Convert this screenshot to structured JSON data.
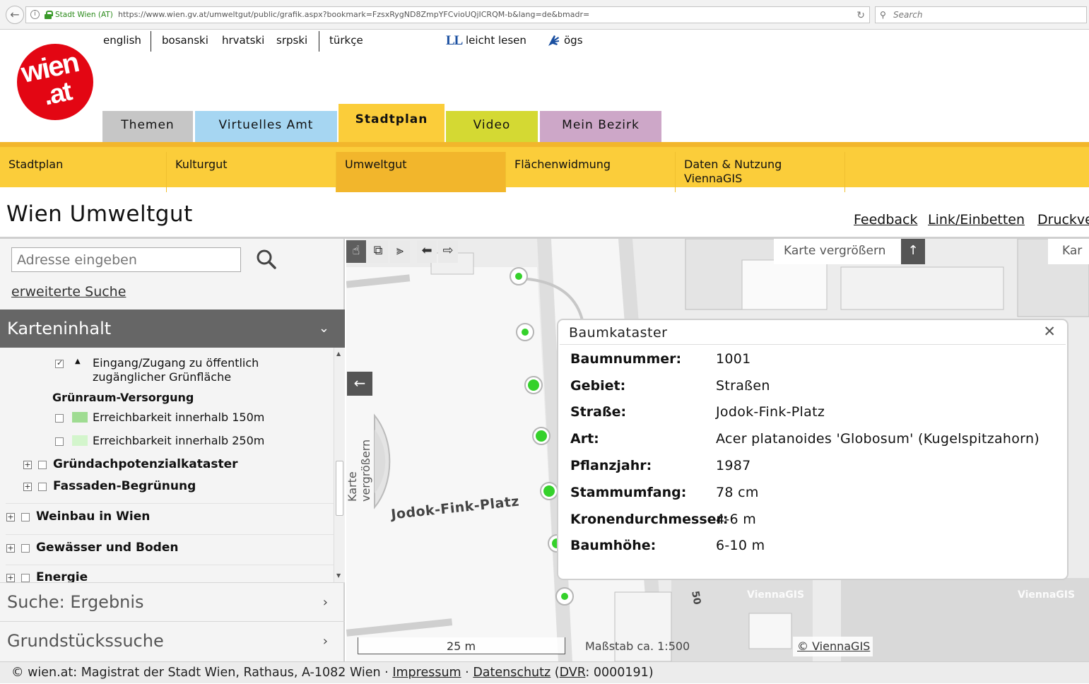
{
  "browser": {
    "site_identity": "Stadt Wien (AT)",
    "url": "https://www.wien.gv.at/umweltgut/public/grafik.aspx?bookmark=FzsxRygND8ZmpYFCvioUQjICRQM-b&lang=de&bmadr=",
    "search_placeholder": "Search"
  },
  "logo": {
    "line1": "wien",
    "line2": ".at"
  },
  "languages": [
    "english",
    "bosanski",
    "hrvatski",
    "srpski",
    "türkçe"
  ],
  "accessibility": {
    "ll_badge": "LL",
    "easy_read": "leicht lesen",
    "sign_language": "ögs"
  },
  "main_tabs": [
    {
      "label": "Themen",
      "color": "#c6c6c6"
    },
    {
      "label": "Virtuelles Amt",
      "color": "#a6d6f2"
    },
    {
      "label": "Stadtplan",
      "color": "#fbcd3a"
    },
    {
      "label": "Video",
      "color": "#d4d933"
    },
    {
      "label": "Mein Bezirk",
      "color": "#cda7c8"
    }
  ],
  "sub_tabs": [
    "Stadtplan",
    "Kulturgut",
    "Umweltgut",
    "Flächenwidmung",
    "Daten & Nutzung",
    "ViennaGIS"
  ],
  "page": {
    "title": "Wien Umweltgut",
    "links": [
      "Feedback",
      "Link/Einbetten",
      "Druckve"
    ]
  },
  "left_panel": {
    "address_placeholder": "Adresse eingeben",
    "advanced_search": "erweiterte Suche",
    "karteninhalt": "Karteninhalt",
    "layers": {
      "entry_line1": "Eingang/Zugang zu öffentlich",
      "entry_line2": "zugänglicher Grünfläche",
      "group_heading": "Grünraum-Versorgung",
      "reach150": "Erreichbarkeit innerhalb 150m",
      "reach250": "Erreichbarkeit innerhalb 250m",
      "roof": "Gründachpotenzialkataster",
      "facade": "Fassaden-Begrünung",
      "wine": "Weinbau in Wien",
      "water": "Gewässer und Boden",
      "energy": "Energie"
    },
    "swatch_colors": {
      "reach150": "#9fdc92",
      "reach250": "#d3f5cc"
    },
    "accordions": [
      "Suche: Ergebnis",
      "Grundstückssuche"
    ]
  },
  "map": {
    "tools": [
      "hand-tool",
      "zoom-box-tool",
      "measure-tool",
      "back-tool",
      "forward-tool"
    ],
    "enlarge_label": "Karte vergrößern",
    "enlarge_label_cut": "Kar",
    "side_label": "Karte vergrößern",
    "place_label": "Jodok-Fink-Platz",
    "watermark": "ViennaGIS",
    "street_number": "50",
    "scale_label": "25 m",
    "scale_ratio": "Maßstab ca. 1:500",
    "credit": "© ViennaGIS",
    "tree_color": "#35d12b"
  },
  "popup": {
    "title": "Baumkataster",
    "rows": [
      {
        "label": "Baumnummer:",
        "value": "1001"
      },
      {
        "label": "Gebiet:",
        "value": "Straßen"
      },
      {
        "label": "Straße:",
        "value": "Jodok-Fink-Platz"
      },
      {
        "label": "Art:",
        "value": "Acer platanoides 'Globosum' (Kugelspitzahorn)"
      },
      {
        "label": "Pflanzjahr:",
        "value": "1987"
      },
      {
        "label": "Stammumfang:",
        "value": "78 cm"
      },
      {
        "label": "Kronendurchmesser:",
        "value": "4-6 m"
      },
      {
        "label": "Baumhöhe:",
        "value": "6-10 m"
      }
    ]
  },
  "footer": {
    "text": "© wien.at: Magistrat der Stadt Wien, Rathaus, A-1082 Wien",
    "impressum": "Impressum",
    "datenschutz": "Datenschutz",
    "dvr_open": "(",
    "dvr": "DVR",
    "dvr_number": ": 0000191)"
  }
}
